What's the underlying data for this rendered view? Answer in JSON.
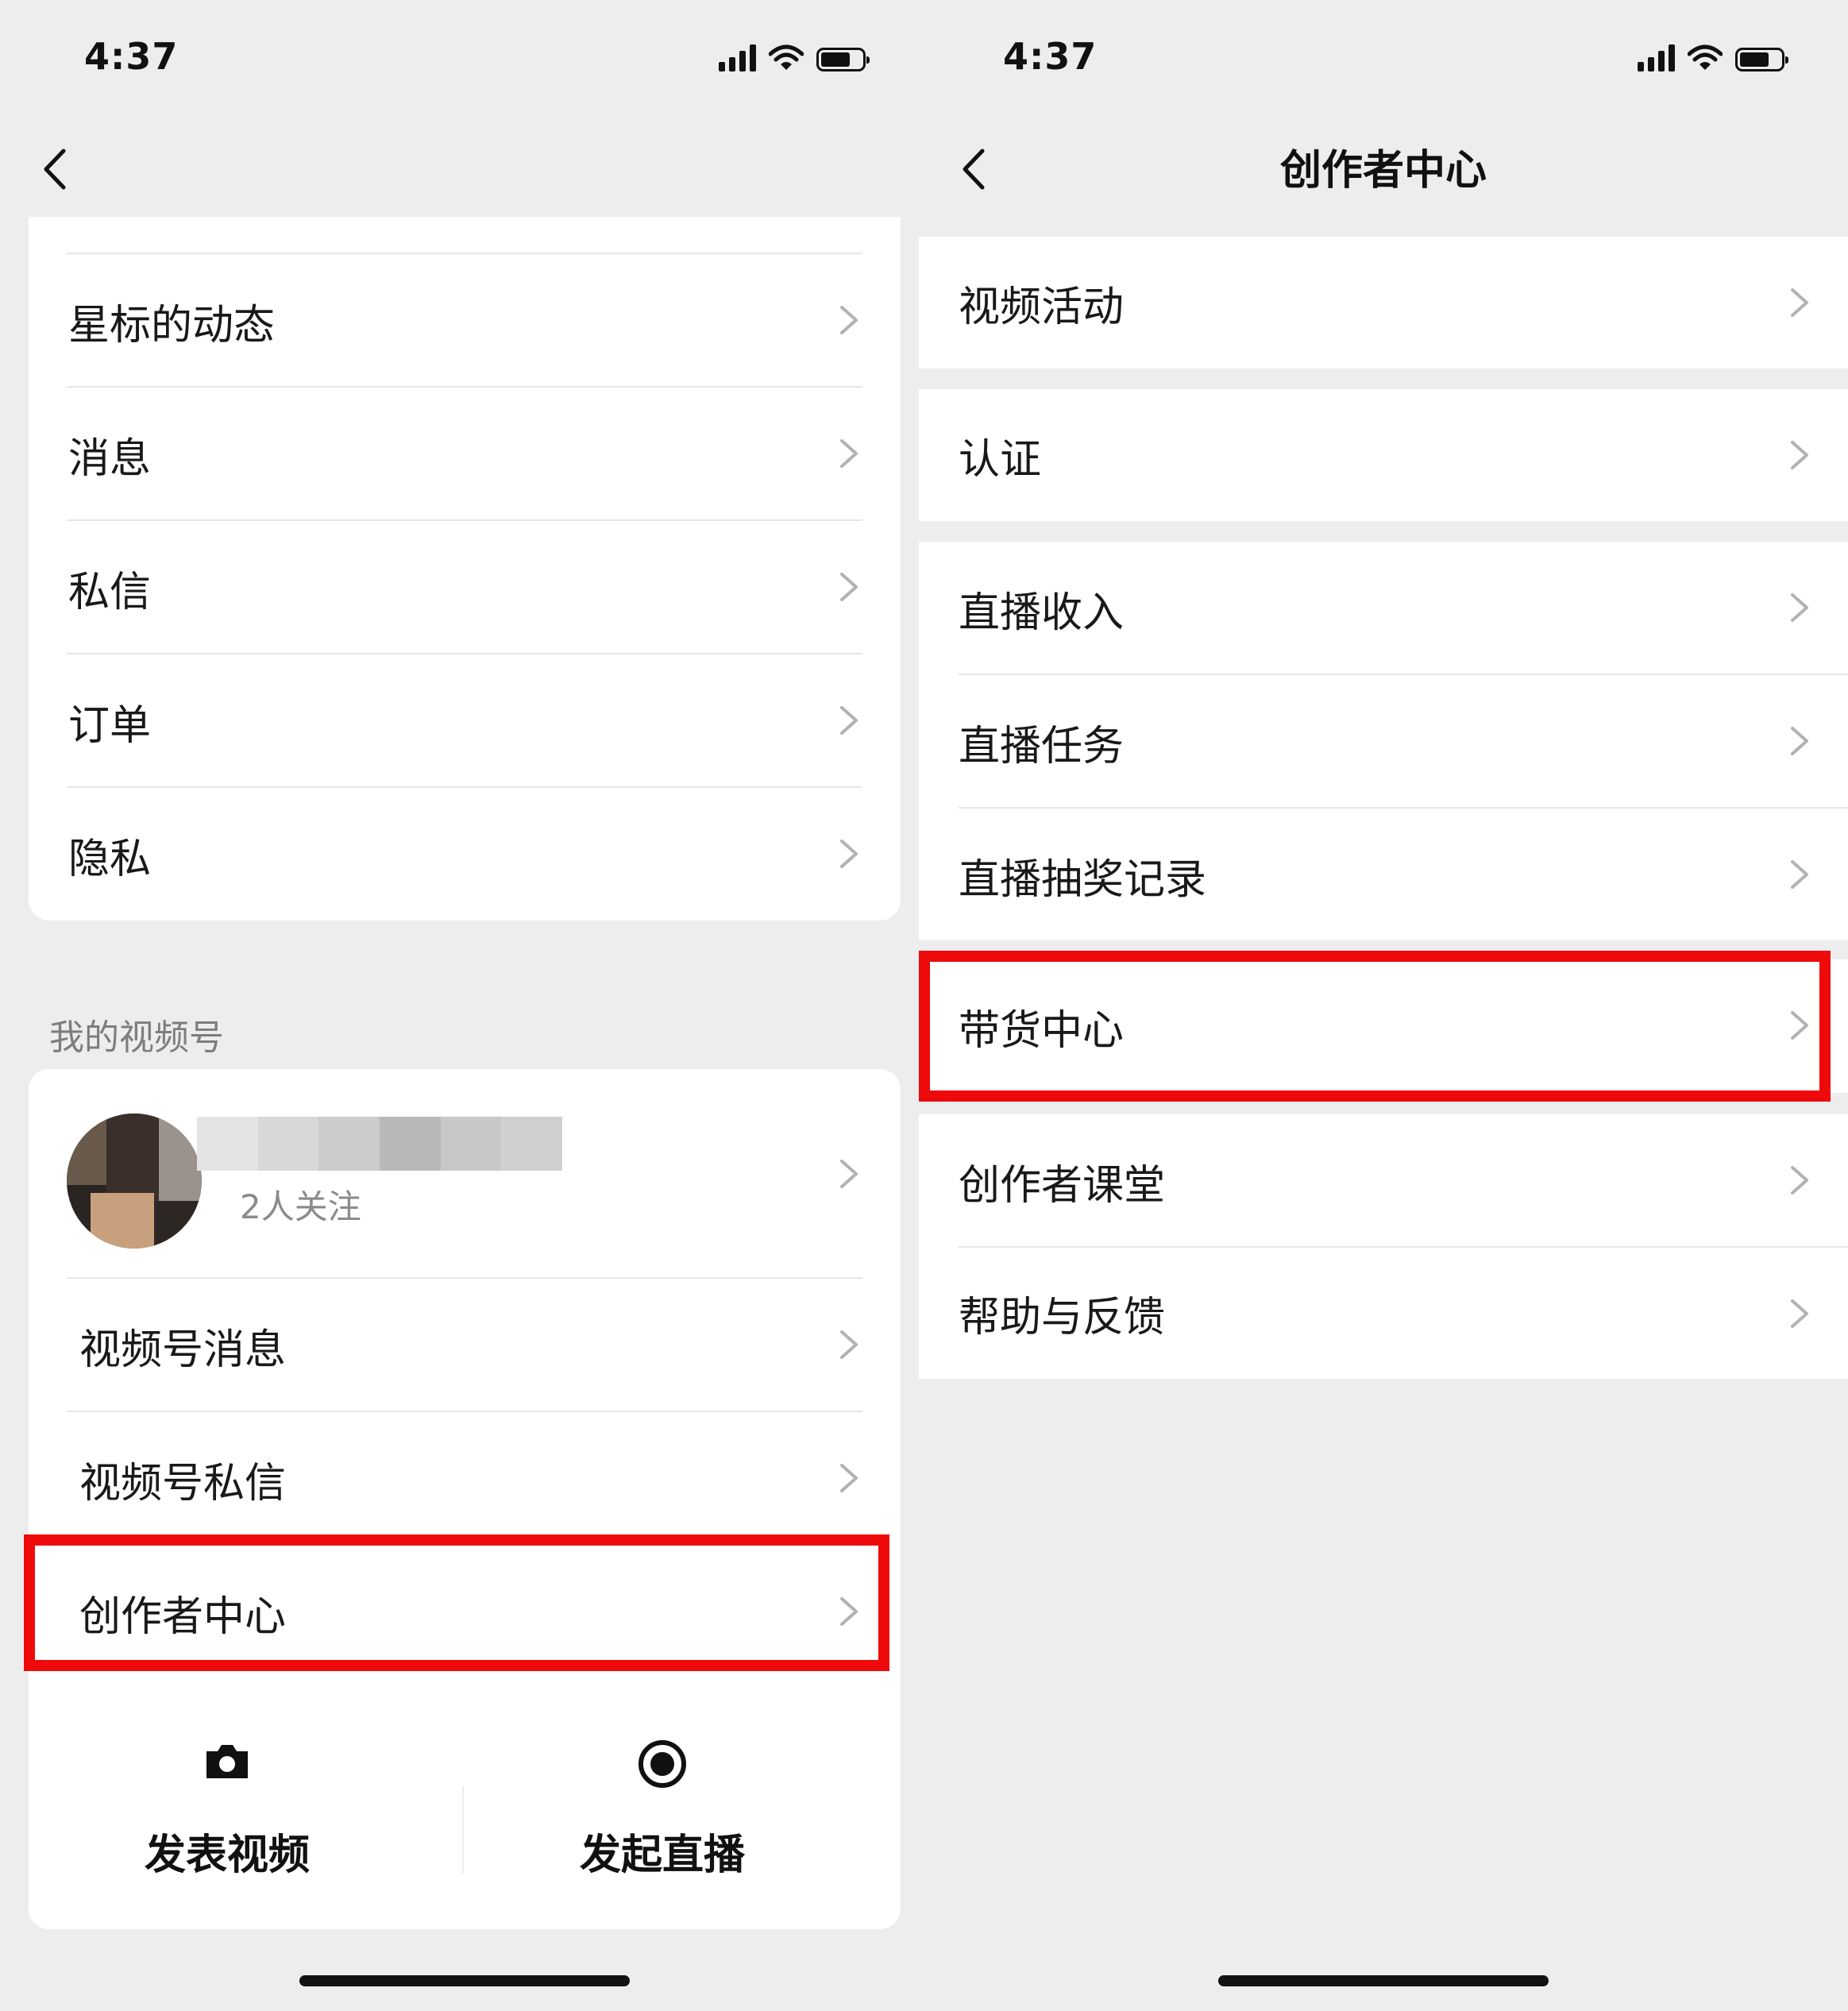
{
  "left_screen": {
    "status_bar": {
      "time": "4:37"
    },
    "menu_items": [
      {
        "label": "星标的动态"
      },
      {
        "label": "消息"
      },
      {
        "label": "私信"
      },
      {
        "label": "订单"
      },
      {
        "label": "隐私"
      }
    ],
    "section_label": "我的视频号",
    "profile": {
      "followers": "2人关注"
    },
    "channel_items": [
      {
        "label": "视频号消息"
      },
      {
        "label": "视频号私信"
      },
      {
        "label": "创作者中心"
      }
    ],
    "actions": {
      "post_video": "发表视频",
      "start_live": "发起直播"
    }
  },
  "right_screen": {
    "status_bar": {
      "time": "4:37"
    },
    "title": "创作者中心",
    "items": [
      {
        "label": "视频活动"
      },
      {
        "label": "认证"
      },
      {
        "label": "直播收入"
      },
      {
        "label": "直播任务"
      },
      {
        "label": "直播抽奖记录"
      },
      {
        "label": "带货中心"
      },
      {
        "label": "创作者课堂"
      },
      {
        "label": "帮助与反馈"
      }
    ]
  },
  "colors": {
    "background": "#ededed",
    "card": "#ffffff",
    "highlight": "#ee0a0a",
    "text": "#191919",
    "secondary_text": "#7d7d7d"
  },
  "icons": [
    "back-icon",
    "chevron-right-icon",
    "camera-icon",
    "live-record-icon",
    "signal-icon",
    "wifi-icon",
    "battery-icon"
  ]
}
